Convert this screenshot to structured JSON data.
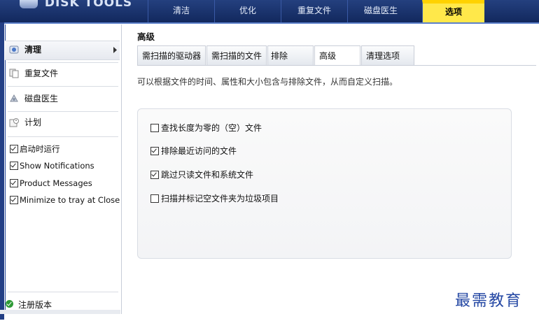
{
  "app": {
    "logo_text": "DISK TOOLS"
  },
  "topnav": {
    "tabs": [
      "清洁",
      "优化",
      "重复文件",
      "磁盘医生",
      "选项"
    ],
    "active": "选项"
  },
  "sidebar": {
    "items": [
      {
        "label": "清理",
        "icon": "cleanup-icon",
        "selected": true,
        "has_arrow": true
      },
      {
        "label": "重复文件",
        "icon": "duplicate-files-icon"
      },
      {
        "label": "磁盘医生",
        "icon": "disk-doctor-icon"
      },
      {
        "label": "计划",
        "icon": "schedule-icon"
      }
    ],
    "checkboxes": [
      {
        "label": "启动时运行",
        "checked": true
      },
      {
        "label": "Show Notifications",
        "checked": true
      },
      {
        "label": "Product Messages",
        "checked": true
      },
      {
        "label": "Minimize to tray at Close",
        "checked": true
      }
    ],
    "register_label": "注册版本"
  },
  "main": {
    "section_title": "高级",
    "tabs": [
      "需扫描的驱动器",
      "需扫描的文件",
      "排除",
      "高级",
      "清理选项"
    ],
    "active_tab": "高级",
    "description": "可以根据文件的时间、属性和大小包含与排除文件，从而自定义扫描。",
    "options": [
      {
        "label": "查找长度为零的（空）文件",
        "checked": false
      },
      {
        "label": "排除最近访问的文件",
        "checked": true
      },
      {
        "label": "跳过只读文件和系统文件",
        "checked": true
      },
      {
        "label": "扫描并标记空文件夹为垃圾项目",
        "checked": false
      }
    ]
  },
  "watermark": "最需教育",
  "colors": {
    "topbar": "#1a3470",
    "active_tab": "#ffe84a",
    "accent_green": "#2e9a36"
  }
}
